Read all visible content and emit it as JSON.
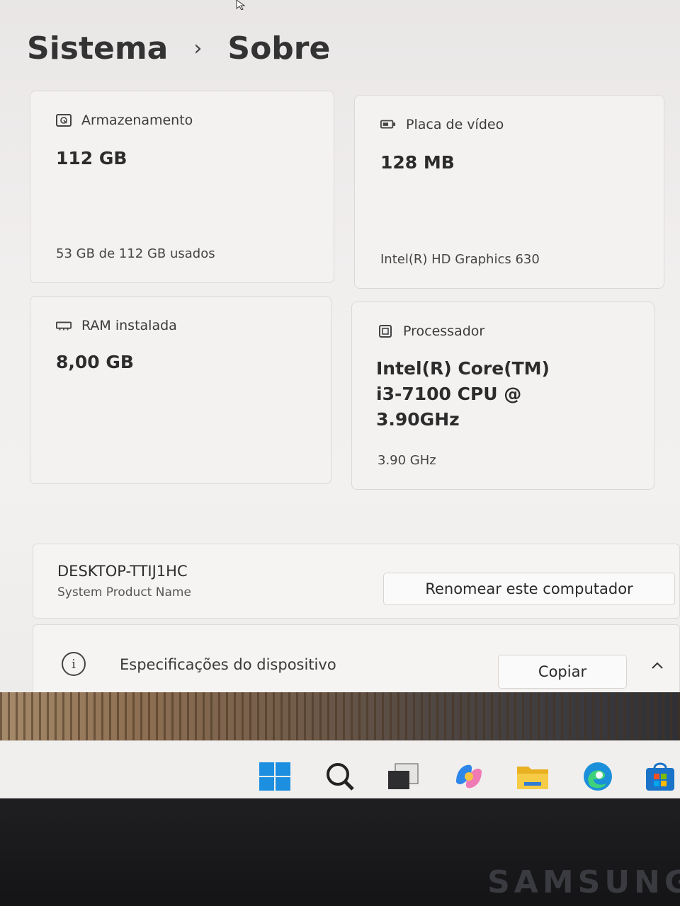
{
  "breadcrumb": {
    "parent": "Sistema",
    "separator": "›",
    "current": "Sobre"
  },
  "cards": {
    "storage": {
      "label": "Armazenamento",
      "icon": "storage-icon",
      "value": "112 GB",
      "detail": "53 GB de 112 GB usados"
    },
    "gpu": {
      "label": "Placa de vídeo",
      "icon": "gpu-icon",
      "value": "128 MB",
      "detail": "Intel(R) HD Graphics 630"
    },
    "ram": {
      "label": "RAM instalada",
      "icon": "ram-icon",
      "value": "8,00 GB"
    },
    "cpu": {
      "label": "Processador",
      "icon": "cpu-icon",
      "value_line1": "Intel(R) Core(TM)",
      "value_line2": "i3-7100 CPU @",
      "value_line3": "3.90GHz",
      "detail": "3.90 GHz"
    }
  },
  "device": {
    "name": "DESKTOP-TTIJ1HC",
    "model": "System Product Name",
    "rename_label": "Renomear este computador"
  },
  "specs": {
    "icon": "info-icon",
    "label": "Especificações do dispositivo",
    "copy_label": "Copiar",
    "expander_icon": "chevron-up-icon"
  },
  "taskbar": {
    "icons": [
      "windows-start-icon",
      "search-icon",
      "task-view-icon",
      "copilot-icon",
      "file-explorer-icon",
      "edge-icon",
      "store-icon"
    ]
  },
  "monitor": {
    "brand": "SAMSUNG"
  },
  "colors": {
    "accent_blue": "#1d8fe0",
    "folder_yellow": "#f3c43a",
    "bezel": "#161618"
  }
}
